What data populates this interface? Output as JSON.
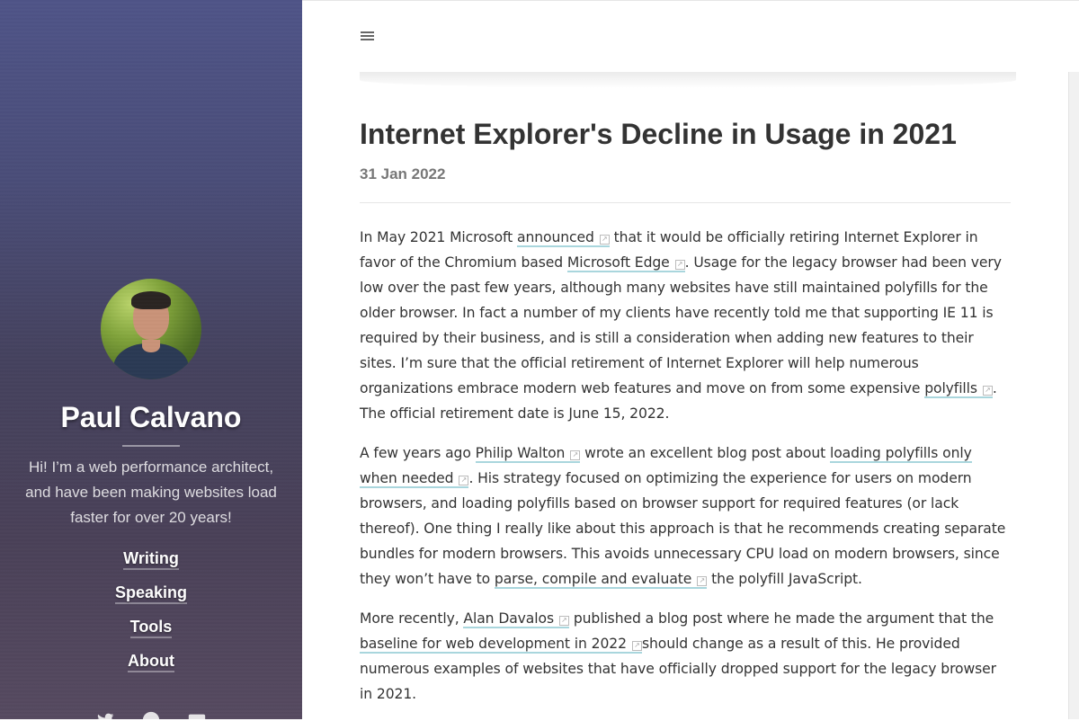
{
  "sidebar": {
    "author_name": "Paul Calvano",
    "bio": "Hi! I’m a web performance architect, and have been making websites load faster for over 20 years!",
    "nav": [
      {
        "label": "Writing"
      },
      {
        "label": "Speaking"
      },
      {
        "label": "Tools"
      },
      {
        "label": "About"
      }
    ],
    "social_icons": [
      "twitter-icon",
      "github-icon",
      "email-icon"
    ]
  },
  "header": {
    "menu_icon": "hamburger-menu-icon"
  },
  "post": {
    "title": "Internet Explorer's Decline in Usage in 2021",
    "date": "31 Jan 2022",
    "p1": {
      "t1": "In May 2021 Microsoft ",
      "link1": "announced",
      "t2": " that it would be officially retiring Internet Explorer in favor of the Chromium based ",
      "link2": "Microsoft Edge",
      "t3": ". Usage for the legacy browser had been very low over the past few years, although many websites have still maintained polyfills for the older browser. In fact a number of my clients have recently told me that supporting IE 11 is required by their business, and is still a consideration when adding new features to their sites. I’m sure that the official retirement of Internet Explorer will help numerous organizations embrace modern web features and move on from some expensive ",
      "link3": "polyfills",
      "t4": ". The official retirement date is June 15, 2022."
    },
    "p2": {
      "t1": "A few years ago ",
      "link1": "Philip Walton",
      "t2": " wrote an excellent blog post about ",
      "link2": "loading polyfills only when needed",
      "t3": ". His strategy focused on optimizing the experience for users on modern browsers, and loading polyfills based on browser support for required features (or lack thereof). One thing I really like about this approach is that he recommends creating separate bundles for modern browsers. This avoids unnecessary CPU load on modern browsers, since they won’t have to ",
      "link3": "parse, compile and evaluate",
      "t4": " the polyfill JavaScript."
    },
    "p3": {
      "t1": "More recently, ",
      "link1": "Alan Davalos",
      "t2": " published a blog post where he made the argument that the ",
      "link2": "baseline for web development in 2022",
      "t3": "should change as a result of this. He provided numerous examples of websites that have officially dropped support for the legacy browser in 2021."
    }
  }
}
